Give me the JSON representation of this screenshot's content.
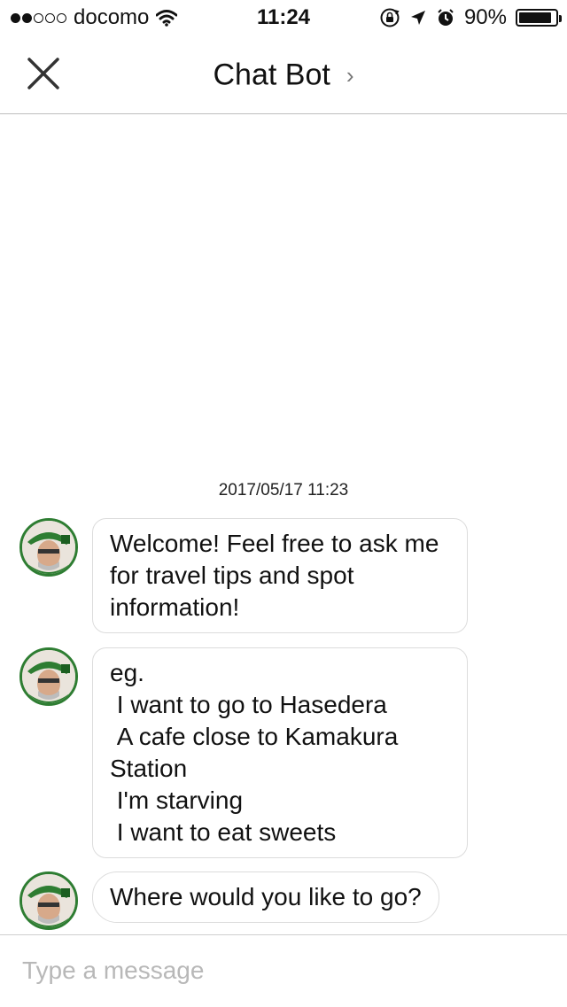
{
  "status_bar": {
    "signal_filled": 2,
    "signal_total": 5,
    "carrier": "docomo",
    "time": "11:24",
    "battery_percent": "90%",
    "battery_level": 0.9,
    "icons": [
      "wifi-icon",
      "rotation-lock-icon",
      "location-arrow-icon",
      "alarm-icon",
      "battery-icon"
    ]
  },
  "nav": {
    "title": "Chat Bot",
    "chevron": "›",
    "close_icon": "close-icon"
  },
  "chat": {
    "timestamp": "2017/05/17 11:23",
    "messages": [
      {
        "sender": "bot",
        "text": "Welcome! Feel free to ask me for travel tips and spot information!"
      },
      {
        "sender": "bot",
        "text": "eg.\n I want to go to Hasedera\n A cafe close to Kamakura Station\n I'm starving\n I want to eat sweets"
      },
      {
        "sender": "bot",
        "text": "Where would you like to go?"
      }
    ]
  },
  "input": {
    "placeholder": "Type a message",
    "value": ""
  },
  "colors": {
    "avatar_ring": "#2e7d32",
    "bubble_border": "#dcdcdc",
    "divider": "#bdbdbd",
    "placeholder": "#b8b8b8"
  }
}
